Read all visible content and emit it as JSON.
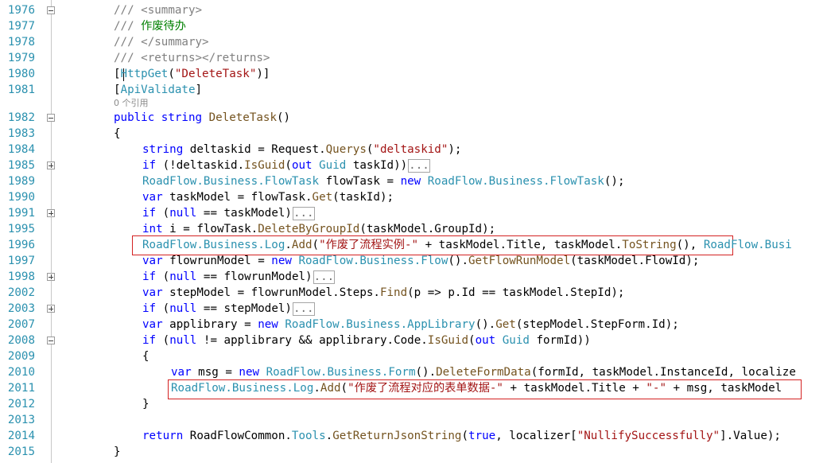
{
  "editor": {
    "lines": [
      {
        "no": "1976",
        "fold": "minus",
        "indent": 2,
        "tokens": [
          {
            "c": "xml",
            "t": "/// <summary>"
          }
        ]
      },
      {
        "no": "1977",
        "fold": "",
        "indent": 2,
        "tokens": [
          {
            "c": "xml",
            "t": "/// "
          },
          {
            "c": "cmt",
            "t": "作废待办"
          }
        ]
      },
      {
        "no": "1978",
        "fold": "",
        "indent": 2,
        "tokens": [
          {
            "c": "xml",
            "t": "/// </summary>"
          }
        ]
      },
      {
        "no": "1979",
        "fold": "",
        "indent": 2,
        "tokens": [
          {
            "c": "xml",
            "t": "/// <returns></returns>"
          }
        ]
      },
      {
        "no": "1980",
        "fold": "",
        "indent": 2,
        "tokens": [
          {
            "c": "plain",
            "t": "["
          },
          {
            "c": "ty",
            "t": "HttpGet"
          },
          {
            "c": "plain",
            "t": "("
          },
          {
            "c": "str",
            "t": "\"DeleteTask\""
          },
          {
            "c": "plain",
            "t": ")]"
          }
        ]
      },
      {
        "no": "1981",
        "fold": "",
        "indent": 2,
        "tokens": [
          {
            "c": "plain",
            "t": "["
          },
          {
            "c": "ty",
            "t": "ApiValidate"
          },
          {
            "c": "plain",
            "t": "]"
          }
        ]
      },
      {
        "no": "1982",
        "fold": "minus",
        "indent": 2,
        "tokens": [
          {
            "c": "kw",
            "t": "public"
          },
          {
            "c": "plain",
            "t": " "
          },
          {
            "c": "kw",
            "t": "string"
          },
          {
            "c": "plain",
            "t": " "
          },
          {
            "c": "mth",
            "t": "DeleteTask"
          },
          {
            "c": "plain",
            "t": "()"
          }
        ]
      },
      {
        "no": "1983",
        "fold": "",
        "indent": 2,
        "tokens": [
          {
            "c": "plain",
            "t": "{"
          }
        ]
      },
      {
        "no": "1984",
        "fold": "",
        "indent": 3,
        "tokens": [
          {
            "c": "kw",
            "t": "string"
          },
          {
            "c": "plain",
            "t": " deltaskid = Request."
          },
          {
            "c": "mth",
            "t": "Querys"
          },
          {
            "c": "plain",
            "t": "("
          },
          {
            "c": "str",
            "t": "\"deltaskid\""
          },
          {
            "c": "plain",
            "t": ");"
          }
        ]
      },
      {
        "no": "1985",
        "fold": "plus",
        "indent": 3,
        "tokens": [
          {
            "c": "kw",
            "t": "if"
          },
          {
            "c": "plain",
            "t": " (!deltaskid."
          },
          {
            "c": "mth",
            "t": "IsGuid"
          },
          {
            "c": "plain",
            "t": "("
          },
          {
            "c": "kw",
            "t": "out"
          },
          {
            "c": "plain",
            "t": " "
          },
          {
            "c": "ty",
            "t": "Guid"
          },
          {
            "c": "plain",
            "t": " taskId))"
          },
          {
            "c": "coll",
            "t": "..."
          }
        ]
      },
      {
        "no": "1989",
        "fold": "",
        "indent": 3,
        "tokens": [
          {
            "c": "ty",
            "t": "RoadFlow.Business.FlowTask"
          },
          {
            "c": "plain",
            "t": " flowTask = "
          },
          {
            "c": "kw",
            "t": "new"
          },
          {
            "c": "plain",
            "t": " "
          },
          {
            "c": "ty",
            "t": "RoadFlow.Business.FlowTask"
          },
          {
            "c": "plain",
            "t": "();"
          }
        ]
      },
      {
        "no": "1990",
        "fold": "",
        "indent": 3,
        "tokens": [
          {
            "c": "kw",
            "t": "var"
          },
          {
            "c": "plain",
            "t": " taskModel = flowTask."
          },
          {
            "c": "mth",
            "t": "Get"
          },
          {
            "c": "plain",
            "t": "(taskId);"
          }
        ]
      },
      {
        "no": "1991",
        "fold": "plus",
        "indent": 3,
        "tokens": [
          {
            "c": "kw",
            "t": "if"
          },
          {
            "c": "plain",
            "t": " ("
          },
          {
            "c": "kw",
            "t": "null"
          },
          {
            "c": "plain",
            "t": " == taskModel)"
          },
          {
            "c": "coll",
            "t": "..."
          }
        ]
      },
      {
        "no": "1995",
        "fold": "",
        "indent": 3,
        "tokens": [
          {
            "c": "kw",
            "t": "int"
          },
          {
            "c": "plain",
            "t": " i = flowTask."
          },
          {
            "c": "mth",
            "t": "DeleteByGroupId"
          },
          {
            "c": "plain",
            "t": "(taskModel.GroupId);"
          }
        ]
      },
      {
        "no": "1996",
        "fold": "",
        "indent": 3,
        "tokens": [
          {
            "c": "ty",
            "t": "RoadFlow.Business.Log"
          },
          {
            "c": "plain",
            "t": "."
          },
          {
            "c": "mth",
            "t": "Add"
          },
          {
            "c": "plain",
            "t": "("
          },
          {
            "c": "str",
            "t": "\"作废了流程实例-\""
          },
          {
            "c": "plain",
            "t": " + taskModel.Title, taskModel."
          },
          {
            "c": "mth",
            "t": "ToString"
          },
          {
            "c": "plain",
            "t": "(), "
          },
          {
            "c": "ty",
            "t": "RoadFlow.Busi"
          }
        ]
      },
      {
        "no": "1997",
        "fold": "",
        "indent": 3,
        "tokens": [
          {
            "c": "kw",
            "t": "var"
          },
          {
            "c": "plain",
            "t": " flowrunModel = "
          },
          {
            "c": "kw",
            "t": "new"
          },
          {
            "c": "plain",
            "t": " "
          },
          {
            "c": "ty",
            "t": "RoadFlow.Business.Flow"
          },
          {
            "c": "plain",
            "t": "()."
          },
          {
            "c": "mth",
            "t": "GetFlowRunModel"
          },
          {
            "c": "plain",
            "t": "(taskModel.FlowId);"
          }
        ]
      },
      {
        "no": "1998",
        "fold": "plus",
        "indent": 3,
        "tokens": [
          {
            "c": "kw",
            "t": "if"
          },
          {
            "c": "plain",
            "t": " ("
          },
          {
            "c": "kw",
            "t": "null"
          },
          {
            "c": "plain",
            "t": " == flowrunModel)"
          },
          {
            "c": "coll",
            "t": "..."
          }
        ]
      },
      {
        "no": "2002",
        "fold": "",
        "indent": 3,
        "tokens": [
          {
            "c": "kw",
            "t": "var"
          },
          {
            "c": "plain",
            "t": " stepModel = flowrunModel.Steps."
          },
          {
            "c": "mth",
            "t": "Find"
          },
          {
            "c": "plain",
            "t": "(p => p.Id == taskModel.StepId);"
          }
        ]
      },
      {
        "no": "2003",
        "fold": "plus",
        "indent": 3,
        "tokens": [
          {
            "c": "kw",
            "t": "if"
          },
          {
            "c": "plain",
            "t": " ("
          },
          {
            "c": "kw",
            "t": "null"
          },
          {
            "c": "plain",
            "t": " == stepModel)"
          },
          {
            "c": "coll",
            "t": "..."
          }
        ]
      },
      {
        "no": "2007",
        "fold": "",
        "indent": 3,
        "tokens": [
          {
            "c": "kw",
            "t": "var"
          },
          {
            "c": "plain",
            "t": " applibrary = "
          },
          {
            "c": "kw",
            "t": "new"
          },
          {
            "c": "plain",
            "t": " "
          },
          {
            "c": "ty",
            "t": "RoadFlow.Business.AppLibrary"
          },
          {
            "c": "plain",
            "t": "()."
          },
          {
            "c": "mth",
            "t": "Get"
          },
          {
            "c": "plain",
            "t": "(stepModel.StepForm.Id);"
          }
        ]
      },
      {
        "no": "2008",
        "fold": "minus",
        "indent": 3,
        "tokens": [
          {
            "c": "kw",
            "t": "if"
          },
          {
            "c": "plain",
            "t": " ("
          },
          {
            "c": "kw",
            "t": "null"
          },
          {
            "c": "plain",
            "t": " != applibrary && applibrary.Code."
          },
          {
            "c": "mth",
            "t": "IsGuid"
          },
          {
            "c": "plain",
            "t": "("
          },
          {
            "c": "kw",
            "t": "out"
          },
          {
            "c": "plain",
            "t": " "
          },
          {
            "c": "ty",
            "t": "Guid"
          },
          {
            "c": "plain",
            "t": " formId))"
          }
        ]
      },
      {
        "no": "2009",
        "fold": "",
        "indent": 3,
        "tokens": [
          {
            "c": "plain",
            "t": "{"
          }
        ]
      },
      {
        "no": "2010",
        "fold": "",
        "indent": 4,
        "tokens": [
          {
            "c": "kw",
            "t": "var"
          },
          {
            "c": "plain",
            "t": " msg = "
          },
          {
            "c": "kw",
            "t": "new"
          },
          {
            "c": "plain",
            "t": " "
          },
          {
            "c": "ty",
            "t": "RoadFlow.Business.Form"
          },
          {
            "c": "plain",
            "t": "()."
          },
          {
            "c": "mth",
            "t": "DeleteFormData"
          },
          {
            "c": "plain",
            "t": "(formId, taskModel.InstanceId, localize"
          }
        ]
      },
      {
        "no": "2011",
        "fold": "",
        "indent": 4,
        "tokens": [
          {
            "c": "ty",
            "t": "RoadFlow.Business.Log"
          },
          {
            "c": "plain",
            "t": "."
          },
          {
            "c": "mth",
            "t": "Add"
          },
          {
            "c": "plain",
            "t": "("
          },
          {
            "c": "str",
            "t": "\"作废了流程对应的表单数据-\""
          },
          {
            "c": "plain",
            "t": " + taskModel.Title + "
          },
          {
            "c": "str",
            "t": "\"-\""
          },
          {
            "c": "plain",
            "t": " + msg, taskModel"
          }
        ]
      },
      {
        "no": "2012",
        "fold": "",
        "indent": 3,
        "tokens": [
          {
            "c": "plain",
            "t": "}"
          }
        ]
      },
      {
        "no": "2013",
        "fold": "",
        "indent": 3,
        "tokens": []
      },
      {
        "no": "2014",
        "fold": "",
        "indent": 3,
        "tokens": [
          {
            "c": "kw",
            "t": "return"
          },
          {
            "c": "plain",
            "t": " RoadFlowCommon."
          },
          {
            "c": "ty",
            "t": "Tools"
          },
          {
            "c": "plain",
            "t": "."
          },
          {
            "c": "mth",
            "t": "GetReturnJsonString"
          },
          {
            "c": "plain",
            "t": "("
          },
          {
            "c": "kw",
            "t": "true"
          },
          {
            "c": "plain",
            "t": ", localizer["
          },
          {
            "c": "str",
            "t": "\"NullifySuccessfully\""
          },
          {
            "c": "plain",
            "t": "].Value);"
          }
        ]
      },
      {
        "no": "2015",
        "fold": "",
        "indent": 2,
        "tokens": [
          {
            "c": "plain",
            "t": "}"
          }
        ]
      }
    ],
    "codelens": "0 个引用"
  }
}
